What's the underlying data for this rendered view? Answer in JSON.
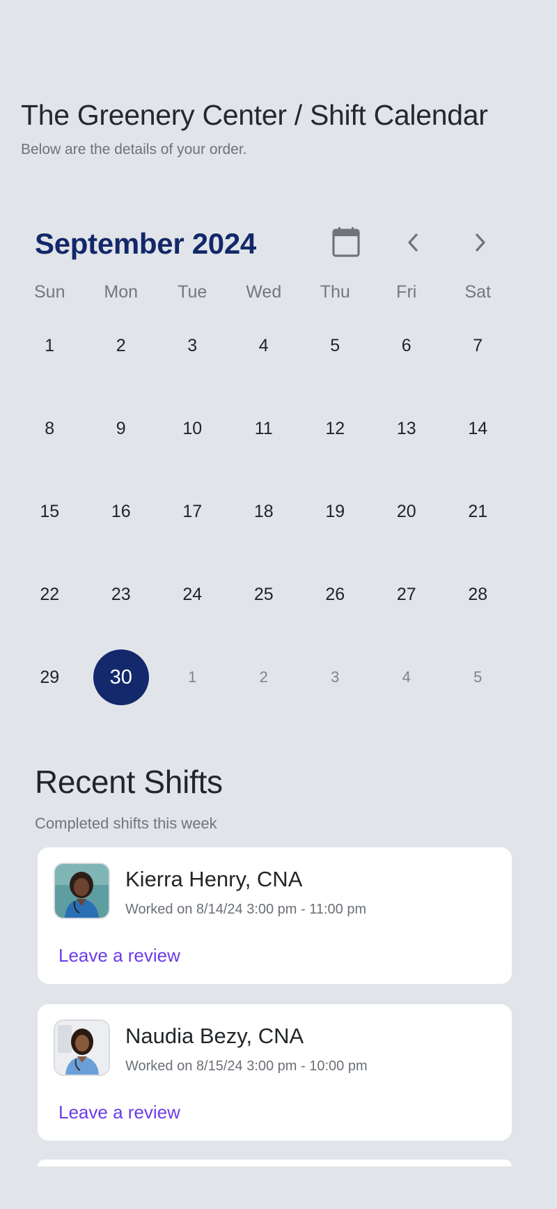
{
  "header": {
    "title": "The Greenery Center / Shift Calendar",
    "subtitle": "Below are the details of your order."
  },
  "calendar": {
    "month_label": "September 2024",
    "calendar_icon": "calendar-icon",
    "prev_icon": "chevron-left-icon",
    "next_icon": "chevron-right-icon",
    "weekdays": [
      "Sun",
      "Mon",
      "Tue",
      "Wed",
      "Thu",
      "Fri",
      "Sat"
    ],
    "weeks": [
      [
        "1",
        "2",
        "3",
        "4",
        "5",
        "6",
        "7"
      ],
      [
        "8",
        "9",
        "10",
        "11",
        "12",
        "13",
        "14"
      ],
      [
        "15",
        "16",
        "17",
        "18",
        "19",
        "20",
        "21"
      ],
      [
        "22",
        "23",
        "24",
        "25",
        "26",
        "27",
        "28"
      ],
      [
        "29",
        "30",
        "1",
        "2",
        "3",
        "4",
        "5"
      ]
    ],
    "selected_day": "30",
    "accent_color": "#13296b"
  },
  "recent_shifts": {
    "title": "Recent Shifts",
    "subtitle": "Completed shifts this week",
    "items": [
      {
        "name": "Kierra Henry, CNA",
        "worked": "Worked on 8/14/24 3:00 pm - 11:00 pm",
        "action": "Leave a review"
      },
      {
        "name": "Naudia Bezy, CNA",
        "worked": "Worked on 8/15/24 3:00 pm - 10:00 pm",
        "action": "Leave a review"
      }
    ],
    "link_color": "#6a3de8"
  }
}
